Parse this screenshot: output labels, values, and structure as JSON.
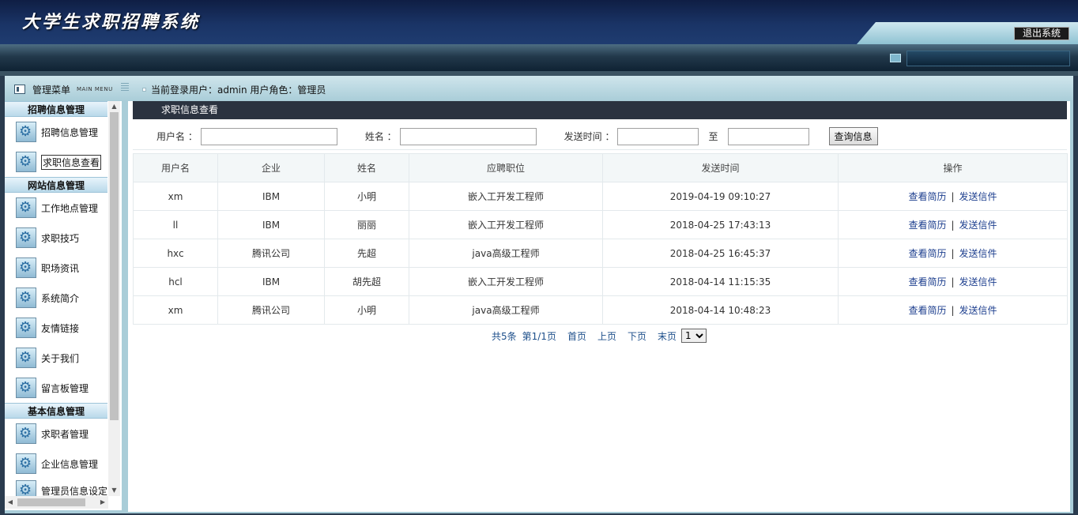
{
  "app": {
    "title": "大学生求职招聘系统",
    "logout_label": "退出系统"
  },
  "info_bar": {
    "menu_title": "管理菜单",
    "menu_subtitle": "MAIN MENU",
    "login_info": "当前登录用户：admin  用户角色：管理员"
  },
  "sidebar": {
    "categories": [
      {
        "title": "招聘信息管理",
        "items": [
          "招聘信息管理",
          "求职信息查看"
        ]
      },
      {
        "title": "网站信息管理",
        "items": [
          "工作地点管理",
          "求职技巧",
          "职场资讯",
          "系统简介",
          "友情链接",
          "关于我们",
          "留言板管理"
        ]
      },
      {
        "title": "基本信息管理",
        "items": [
          "求职者管理",
          "企业信息管理",
          "管理员信息设定"
        ]
      }
    ],
    "active_item": "求职信息查看"
  },
  "panel": {
    "title": "求职信息查看",
    "search": {
      "username_label": "用户名 ：",
      "username_value": "",
      "name_label": "姓名 ：",
      "name_value": "",
      "time_label": "发送时间 ：",
      "time_from": "",
      "to_label": "至",
      "time_to": "",
      "button_label": "查询信息"
    },
    "table": {
      "headers": [
        "用户名",
        "企业",
        "姓名",
        "应聘职位",
        "发送时间",
        "操作"
      ],
      "rows": [
        {
          "username": "xm",
          "company": "IBM",
          "name": "小明",
          "position": "嵌入工开发工程师",
          "time": "2019-04-19 09:10:27",
          "op1": "查看简历",
          "op2": "发送信件"
        },
        {
          "username": "ll",
          "company": "IBM",
          "name": "丽丽",
          "position": "嵌入工开发工程师",
          "time": "2018-04-25 17:43:13",
          "op1": "查看简历",
          "op2": "发送信件"
        },
        {
          "username": "hxc",
          "company": "腾讯公司",
          "name": "先超",
          "position": "java高级工程师",
          "time": "2018-04-25 16:45:37",
          "op1": "查看简历",
          "op2": "发送信件"
        },
        {
          "username": "hcl",
          "company": "IBM",
          "name": "胡先超",
          "position": "嵌入工开发工程师",
          "time": "2018-04-14 11:15:35",
          "op1": "查看简历",
          "op2": "发送信件"
        },
        {
          "username": "xm",
          "company": "腾讯公司",
          "name": "小明",
          "position": "java高级工程师",
          "time": "2018-04-14 10:48:23",
          "op1": "查看简历",
          "op2": "发送信件"
        }
      ]
    },
    "pager": {
      "total": "共5条",
      "page_info": "第1/1页",
      "first": "首页",
      "prev": "上页",
      "next": "下页",
      "last": "末页",
      "page_options": [
        "1"
      ],
      "selected_page": "1"
    }
  },
  "colors": {
    "header_bg": "#1a3466",
    "panel_title_bg": "#2b3340",
    "link": "#1c3e8e",
    "frame_bg": "#a9cdd8"
  }
}
